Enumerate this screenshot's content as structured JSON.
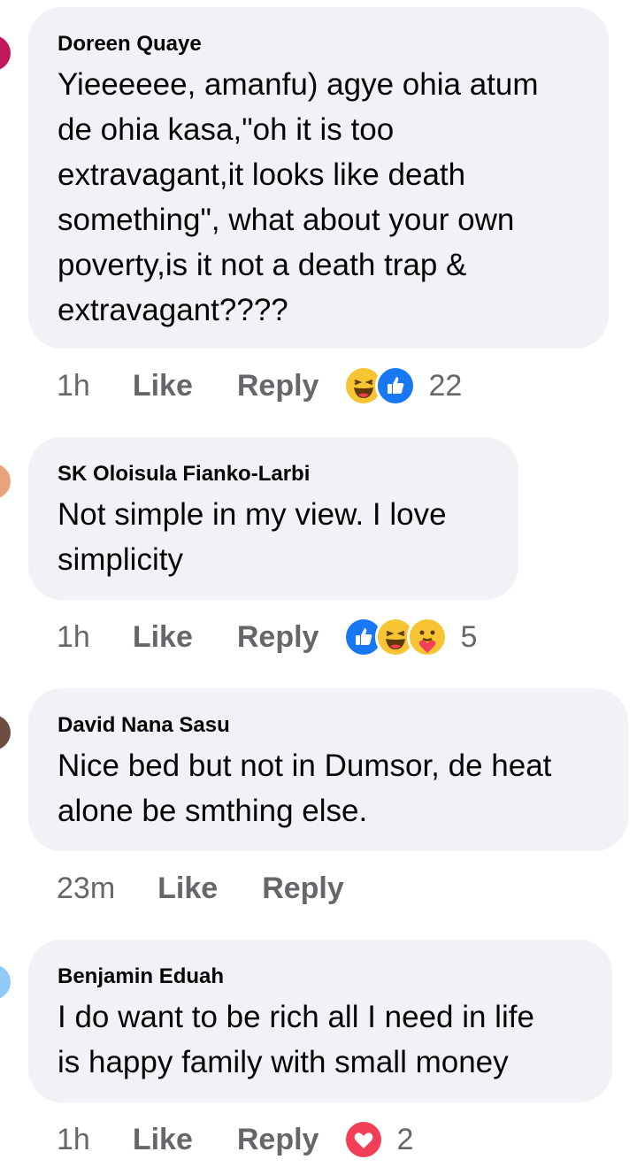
{
  "comments": [
    {
      "author": "Doreen Quaye",
      "text": "Yieeeeee, amanfu) agye ohia atum\nde ohia kasa,\"oh it is too\nextravagant,it looks like death\nsomething\", what about your own\npoverty,is it not a death trap &\nextravagant????",
      "time": "1h",
      "like": "Like",
      "reply": "Reply",
      "reactions": [
        "haha-icon",
        "like-icon"
      ],
      "count": "22",
      "avatar_color": "#c2185b"
    },
    {
      "author": "SK Oloisula Fianko-Larbi",
      "text": "Not simple in my view. I love\nsimplicity",
      "time": "1h",
      "like": "Like",
      "reply": "Reply",
      "reactions": [
        "like-icon",
        "haha-icon",
        "care-icon"
      ],
      "count": "5",
      "avatar_color": "#e8a27c"
    },
    {
      "author": "David Nana Sasu",
      "text": "Nice bed but not in Dumsor, de heat\nalone be smthing else.",
      "time": "23m",
      "like": "Like",
      "reply": "Reply",
      "reactions": [],
      "count": "",
      "avatar_color": "#6d4c41"
    },
    {
      "author": "Benjamin Eduah",
      "text": "I do want to be rich all I need in life\nis happy family with small money",
      "time": "1h",
      "like": "Like",
      "reply": "Reply",
      "reactions": [
        "love-icon"
      ],
      "count": "2",
      "avatar_color": "#90caf9"
    }
  ],
  "colors": {
    "bubble": "#f0f2f5",
    "meta": "#65676b",
    "like_blue": "#1877f2",
    "haha_yellow": "#f7c533",
    "love_red": "#f33e58"
  }
}
